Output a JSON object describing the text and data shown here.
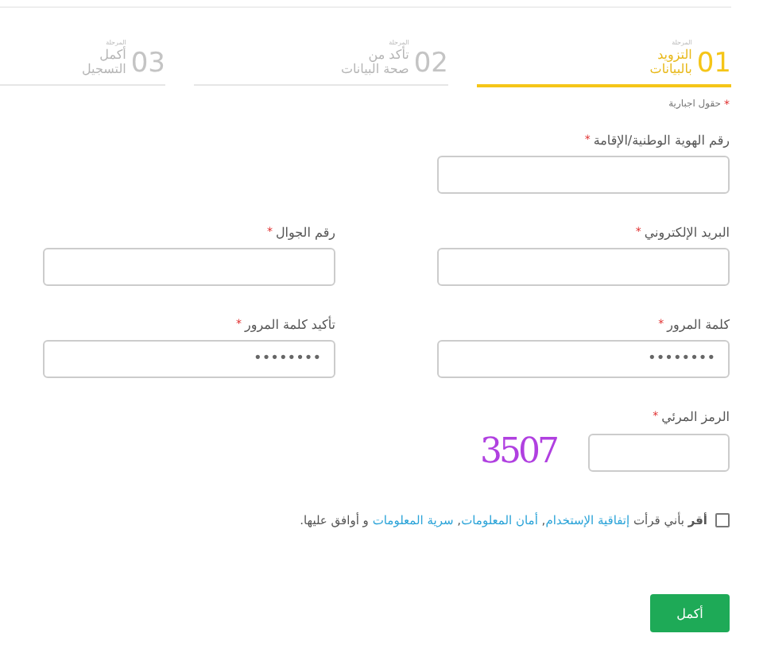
{
  "steps": [
    {
      "caption": "المرحلة",
      "title": "التزويد بالبيانات",
      "number": "01",
      "selected": true
    },
    {
      "caption": "المرحلة",
      "title": "تأكد من صحة البيانات",
      "number": "02",
      "selected": false
    },
    {
      "caption": "المرحلة",
      "title": "أكمل التسجيل",
      "number": "03",
      "selected": false
    }
  ],
  "required_note": {
    "marker": "*",
    "text": "حقول اجبارية"
  },
  "fields": [
    {
      "label": "رقم الهوية الوطنية/الإقامة",
      "marker": "*",
      "kind": "text"
    },
    {
      "kind": "spacer"
    },
    {
      "label": "البريد الإلكتروني",
      "marker": "*",
      "kind": "text"
    },
    {
      "label": "رقم الجوال",
      "marker": "*",
      "kind": "text"
    },
    {
      "label": "كلمة المرور",
      "marker": "*",
      "kind": "text",
      "value": "••••••••"
    },
    {
      "label": "تأكيد كلمة المرور",
      "marker": "*",
      "kind": "text",
      "value": "••••••••"
    },
    {
      "label": "الرمز المرئي",
      "marker": "*",
      "kind": "captcha",
      "captcha": "3507"
    }
  ],
  "consent": {
    "checked": false,
    "parts": [
      {
        "kind": "text",
        "text": "**أقر** بأني قرأت "
      },
      {
        "kind": "link",
        "text": "إتفاقية الإستخدام"
      },
      {
        "kind": "text",
        "text": ", "
      },
      {
        "kind": "link",
        "text": "أمان المعلومات"
      },
      {
        "kind": "text",
        "text": ", "
      },
      {
        "kind": "link",
        "text": "سرية المعلومات"
      },
      {
        "kind": "text",
        "text": " و أوافق عليها."
      }
    ]
  },
  "submit": "أكمل"
}
